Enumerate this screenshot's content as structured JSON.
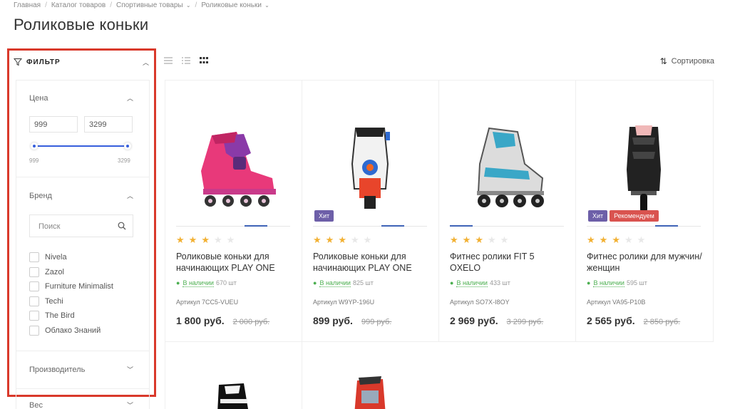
{
  "breadcrumb": {
    "items": [
      "Главная",
      "Каталог товаров",
      "Спортивные товары",
      "Роликовые коньки"
    ]
  },
  "page_title": "Роликовые коньки",
  "filter": {
    "title": "ФИЛЬТР",
    "price": {
      "label": "Цена",
      "min_value": "999",
      "max_value": "3299",
      "range_min_label": "999",
      "range_max_label": "3299"
    },
    "brand": {
      "label": "Бренд",
      "search_placeholder": "Поиск",
      "items": [
        "Nivela",
        "Zazol",
        "Furniture Minimalist",
        "Techi",
        "The Bird",
        "Облако Знаний"
      ]
    },
    "manufacturer_label": "Производитель",
    "weight_label": "Вес"
  },
  "toolbar": {
    "sort_label": "Сортировка"
  },
  "products": [
    {
      "name": "Роликовые коньки для начинающих PLAY ONE",
      "stock_label": "В наличии",
      "stock_count": "670 шт",
      "sku": "Артикул 7CC5-VUEU",
      "price": "1 800 руб.",
      "old_price": "2 000 руб.",
      "rating": 3,
      "badges": []
    },
    {
      "name": "Роликовые коньки для начинающих PLAY ONE",
      "stock_label": "В наличии",
      "stock_count": "825 шт",
      "sku": "Артикул W9YP-196U",
      "price": "899 руб.",
      "old_price": "999 руб.",
      "rating": 3,
      "badges": [
        "Хит"
      ]
    },
    {
      "name": "Фитнес ролики FIT 5 OXELO",
      "stock_label": "В наличии",
      "stock_count": "433 шт",
      "sku": "Артикул SO7X-I8OY",
      "price": "2 969 руб.",
      "old_price": "3 299 руб.",
      "rating": 3,
      "badges": []
    },
    {
      "name": "Фитнес ролики для мужчин/женщин",
      "stock_label": "В наличии",
      "stock_count": "595 шт",
      "sku": "Артикул VA95-P10B",
      "price": "2 565 руб.",
      "old_price": "2 850 руб.",
      "rating": 3,
      "badges": [
        "Хит",
        "Рекомендуем"
      ]
    }
  ],
  "colors": {
    "accent": "#365edc",
    "highlight_border": "#d9392b",
    "star": "#f2b134",
    "in_stock": "#4caf50",
    "badge_hit": "#6d5fa8",
    "badge_recommended": "#d9534f"
  }
}
